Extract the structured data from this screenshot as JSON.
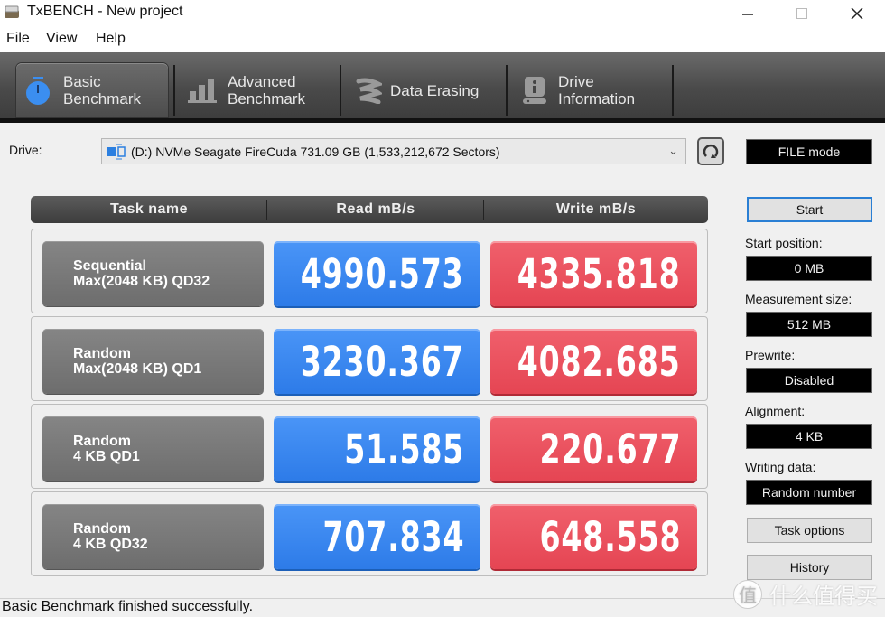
{
  "window": {
    "title": "TxBENCH - New project",
    "controls": [
      "minimize",
      "maximize",
      "close"
    ]
  },
  "menu": [
    "File",
    "View",
    "Help"
  ],
  "tabs": [
    {
      "label_line1": "Basic",
      "label_line2": "Benchmark",
      "icon": "stopwatch-icon",
      "active": true
    },
    {
      "label_line1": "Advanced",
      "label_line2": "Benchmark",
      "icon": "bar-chart-icon",
      "active": false
    },
    {
      "label_line1": "Data Erasing",
      "label_line2": "",
      "icon": "eraser-icon",
      "active": false
    },
    {
      "label_line1": "Drive",
      "label_line2": "Information",
      "icon": "drive-info-icon",
      "active": false
    }
  ],
  "drive": {
    "label": "Drive:",
    "selected": "(D:) NVMe Seagate FireCuda  731.09 GB (1,533,212,672 Sectors)"
  },
  "mode": "FILE mode",
  "table": {
    "headers": [
      "Task name",
      "Read mB/s",
      "Write mB/s"
    ],
    "rows": [
      {
        "task_line1": "Sequential",
        "task_line2": "Max(2048 KB) QD32",
        "read": "4990.573",
        "write": "4335.818"
      },
      {
        "task_line1": "Random",
        "task_line2": "Max(2048 KB) QD1",
        "read": "3230.367",
        "write": "4082.685"
      },
      {
        "task_line1": "Random",
        "task_line2": "4 KB QD1",
        "read": "51.585",
        "write": "220.677"
      },
      {
        "task_line1": "Random",
        "task_line2": "4 KB QD32",
        "read": "707.834",
        "write": "648.558"
      }
    ]
  },
  "sidebar": {
    "start_button": "Start",
    "start_position_label": "Start position:",
    "start_position_value": "0 MB",
    "measurement_size_label": "Measurement size:",
    "measurement_size_value": "512 MB",
    "prewrite_label": "Prewrite:",
    "prewrite_value": "Disabled",
    "alignment_label": "Alignment:",
    "alignment_value": "4 KB",
    "writing_data_label": "Writing data:",
    "writing_data_value": "Random number",
    "task_options_button": "Task options",
    "history_button": "History"
  },
  "status": "Basic Benchmark finished successfully.",
  "watermark": {
    "badge": "值",
    "text": "什么值得买"
  },
  "colors": {
    "read": "#3385f0",
    "write": "#ea4f5c",
    "tab_active_icon": "#3b8ef0"
  }
}
